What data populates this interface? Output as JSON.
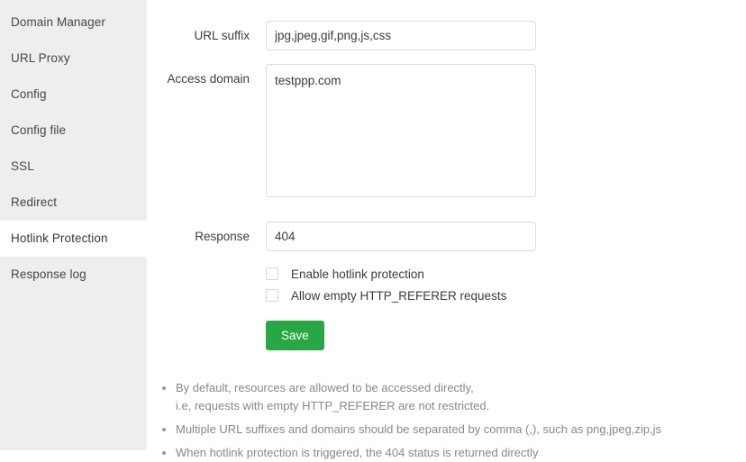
{
  "sidebar": {
    "items": [
      {
        "label": "Domain Manager",
        "active": false
      },
      {
        "label": "URL Proxy",
        "active": false
      },
      {
        "label": "Config",
        "active": false
      },
      {
        "label": "Config file",
        "active": false
      },
      {
        "label": "SSL",
        "active": false
      },
      {
        "label": "Redirect",
        "active": false
      },
      {
        "label": "Hotlink Protection",
        "active": true
      },
      {
        "label": "Response log",
        "active": false
      }
    ]
  },
  "form": {
    "url_suffix": {
      "label": "URL suffix",
      "value": "jpg,jpeg,gif,png,js,css",
      "placeholder": ""
    },
    "access_domain": {
      "label": "Access domain",
      "value": "testppp.com",
      "placeholder": ""
    },
    "response": {
      "label": "Response",
      "value": "404",
      "placeholder": ""
    },
    "checkboxes": [
      {
        "label": "Enable hotlink protection",
        "checked": false
      },
      {
        "label": "Allow empty HTTP_REFERER requests",
        "checked": false
      }
    ],
    "save_label": "Save"
  },
  "notes": [
    {
      "line1": "By default, resources are allowed to be accessed directly,",
      "line2": "i.e, requests with empty HTTP_REFERER are not restricted."
    },
    {
      "line1": "Multiple URL suffixes and domains should be separated by comma (,), such as png,jpeg,zip,js",
      "line2": ""
    },
    {
      "line1": "When hotlink protection is triggered, the 404 status is returned directly",
      "line2": ""
    }
  ],
  "colors": {
    "accent_green": "#28a745",
    "sidebar_bg": "#eeeeee",
    "text": "#3c3c3c",
    "muted_text": "#888888",
    "border": "#dcdcdc"
  }
}
